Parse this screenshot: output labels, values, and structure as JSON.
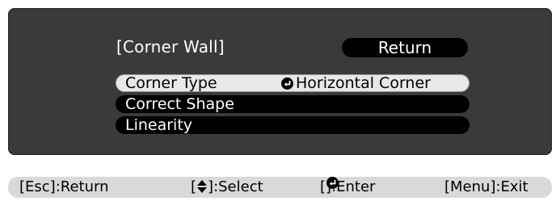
{
  "menu": {
    "title": "[Corner Wall]",
    "return_label": "Return",
    "items": [
      {
        "label": "Corner Type",
        "value": "Horizontal Corner",
        "selected": true
      },
      {
        "label": "Correct Shape",
        "value": "",
        "selected": false
      },
      {
        "label": "Linearity",
        "value": "",
        "selected": false
      }
    ]
  },
  "footer": {
    "esc_key": "[Esc]",
    "esc_action": ":Return",
    "select_key_open": "[",
    "select_key_close": "]",
    "select_action": ":Select",
    "enter_key_open": "[",
    "enter_key_close": "]",
    "enter_action": ":Enter",
    "menu_key": "[Menu]",
    "menu_action": ":Exit"
  },
  "icons": {
    "enter": "enter-icon",
    "up-down": "up-down-arrow-icon"
  },
  "colors": {
    "panel_bg": "#3a3a3a",
    "item_bg": "#000000",
    "selected_bg": "#e8e8e8",
    "footer_bg": "#d9d9d9"
  }
}
